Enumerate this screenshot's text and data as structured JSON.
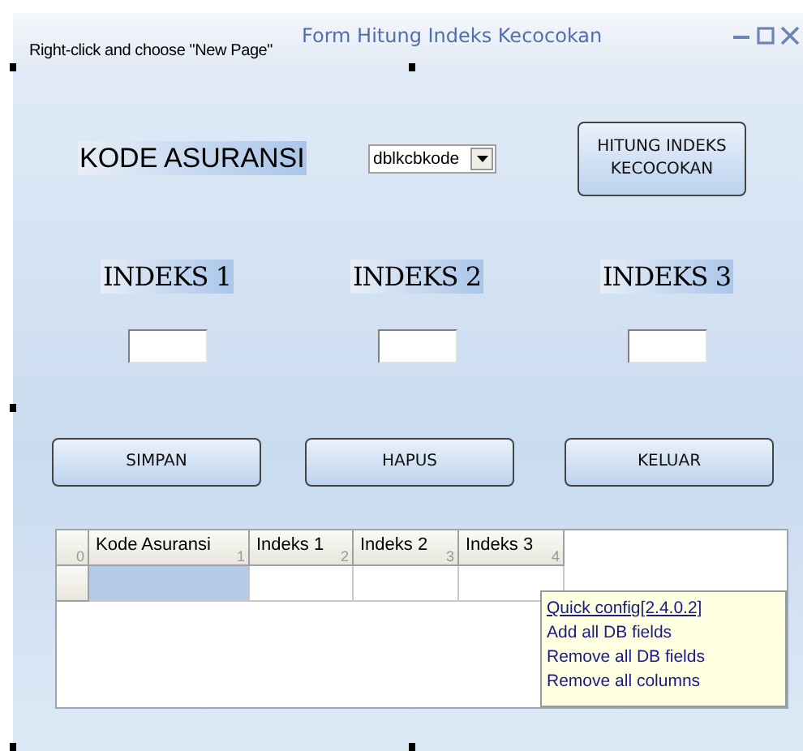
{
  "window": {
    "title": "Form Hitung Indeks Kecocokan"
  },
  "design_hint": "Right-click and choose \"New Page\"",
  "insurance_code": {
    "label": "KODE ASURANSI",
    "combo_value": "dblkcbkode"
  },
  "calculate_button": "HITUNG INDEKS KECOCOKAN",
  "indexes": [
    {
      "label": "INDEKS 1"
    },
    {
      "label": "INDEKS 2"
    },
    {
      "label": "INDEKS 3"
    }
  ],
  "buttons": [
    "SIMPAN",
    "HAPUS",
    "KELUAR"
  ],
  "grid": {
    "columns": [
      {
        "number": "0"
      },
      {
        "label": "Kode Asuransi",
        "number": "1"
      },
      {
        "label": "Indeks 1",
        "number": "2"
      },
      {
        "label": "Indeks 2",
        "number": "3"
      },
      {
        "label": "Indeks 3",
        "number": "4"
      }
    ],
    "rows": [
      {
        "cells": [
          {
            "selected": true
          },
          {
            "selected": false
          },
          {
            "selected": false
          },
          {
            "selected": false
          }
        ]
      }
    ]
  },
  "quick_config": {
    "items": [
      {
        "label": "Quick config[2.4.0.2]",
        "kind": "link"
      },
      {
        "label": "Add all DB fields",
        "kind": "action"
      },
      {
        "label": "Remove all DB fields",
        "kind": "action"
      },
      {
        "label": "Remove all columns",
        "kind": "action"
      }
    ]
  }
}
